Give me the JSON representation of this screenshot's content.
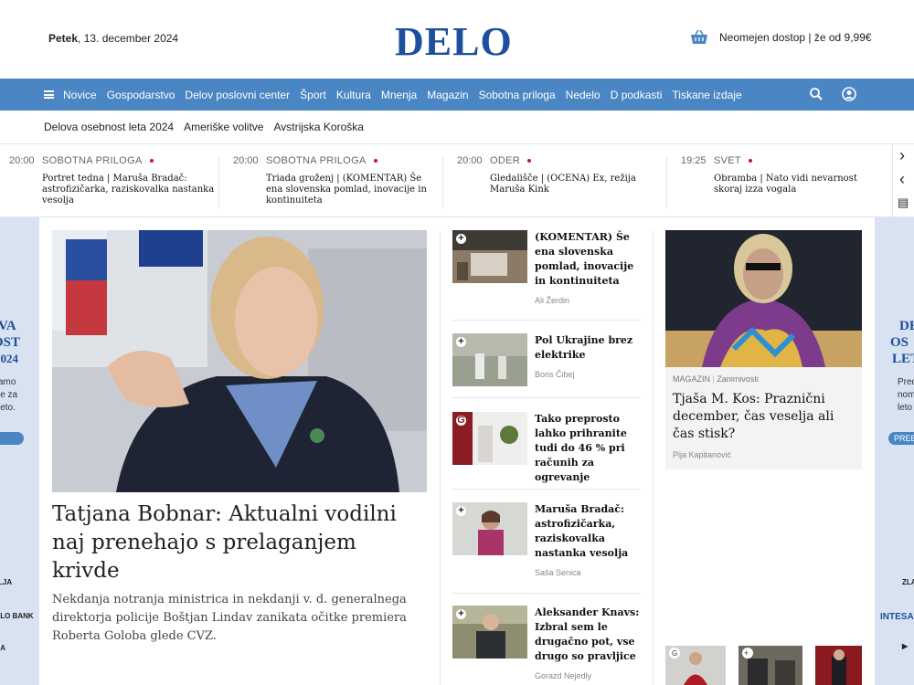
{
  "header": {
    "weekday": "Petek",
    "date": ", 13. december 2024",
    "logo": "DELO",
    "subscription": "Neomejen dostop | že od 9,99€"
  },
  "nav": {
    "items": [
      "Novice",
      "Gospodarstvo",
      "Delov poslovni center",
      "Šport",
      "Kultura",
      "Mnenja",
      "Magazin",
      "Sobotna priloga",
      "Nedelo",
      "D podkasti",
      "Tiskane izdaje"
    ],
    "icons": [
      "menu-icon",
      "search-icon",
      "user-icon"
    ],
    "accent": "#4a85c4"
  },
  "topics": [
    "Delova osebnost leta 2024",
    "Ameriške volitve",
    "Avstrijska Koroška"
  ],
  "ticker": [
    {
      "time": "20:00",
      "category": "SOBOTNA PRILOGA",
      "title": "Portret tedna | Maruša Bradač: astrofizičarka, raziskovalka nastanka vesolja"
    },
    {
      "time": "20:00",
      "category": "SOBOTNA PRILOGA",
      "title": "Triada groženj | (KOMENTAR) Še ena slovenska pomlad, inovacije in kontinuiteta"
    },
    {
      "time": "20:00",
      "category": "ODER",
      "title": "Gledališče | (OCENA) Ex, režija Maruša Kink"
    },
    {
      "time": "19:25",
      "category": "SVET",
      "title": "Obramba | Nato vidi nevarnost skoraj izza vogala"
    }
  ],
  "ad_left": {
    "lines": [
      "VA",
      "OST",
      "2024"
    ],
    "small": [
      "amo",
      "le za",
      "leto."
    ],
    "logo1": "LJA",
    "logo2": "OLO BANK",
    "logo3": "IA"
  },
  "ad_right": {
    "lines": [
      "DE",
      "OS",
      "LET"
    ],
    "small": [
      "Pred",
      "nom",
      "leto"
    ],
    "btn": "PREB",
    "logo1": "ZLAT",
    "logo2": "INTESA",
    "logo3": "▶"
  },
  "main": {
    "title": "Tatjana Bobnar: Aktualni vodilni naj prenehajo s prelaganjem krivde",
    "lead": "Nekdanja notranja ministrica in nekdanji v. d. generalnega direktorja policije Boštjan Lindav zanikata očitke premiera Roberta Goloba glede CVZ."
  },
  "list": [
    {
      "title": "(KOMENTAR) Še ena slovenska pomlad, inovacije in kontinuiteta",
      "author": "Ali Žerdin"
    },
    {
      "title": "Pol Ukrajine brez elektrike",
      "author": "Boris Čibej"
    },
    {
      "title": "Tako preprosto lahko prihranite tudi do 46 % pri računih za ogrevanje",
      "author": ""
    },
    {
      "title": "Maruša Bradač: astrofizičarka, raziskovalka nastanka vesolja",
      "author": "Saša Senica"
    },
    {
      "title": "Aleksander Knavs: Izbral sem le drugačno pot, vse drugo so pravljice",
      "author": "Gorazd Nejedly"
    }
  ],
  "feature": {
    "section": "MAGAZIN",
    "subsection": "Zanimivosti",
    "title": "Tjaša M. Kos: Praznični december, čas veselja ali čas stisk?",
    "author": "Pija Kapitanović"
  },
  "ticker_nav": {
    "next": "›",
    "prev": "‹",
    "edition": "▤"
  }
}
